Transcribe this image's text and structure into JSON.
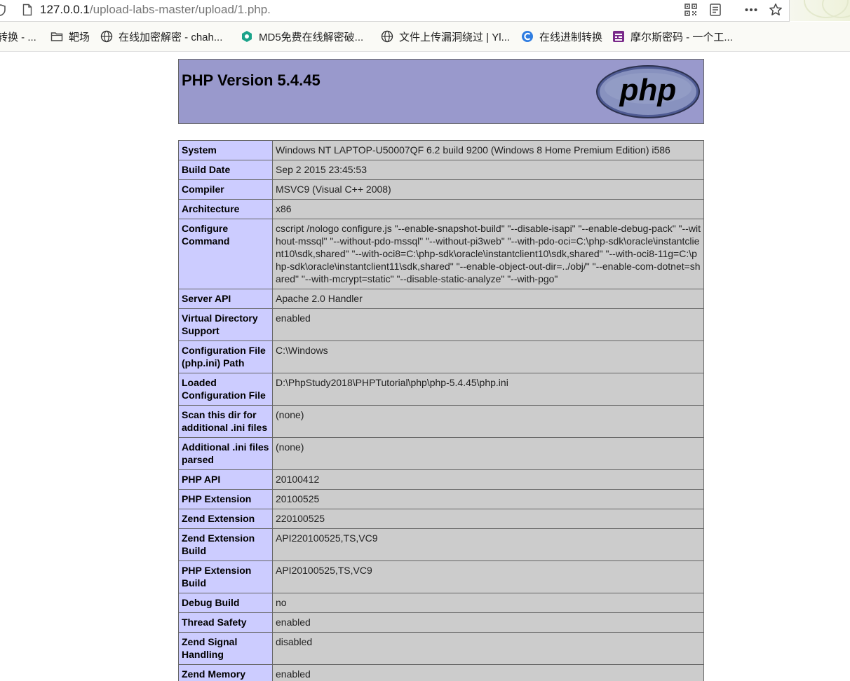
{
  "browser": {
    "url_host": "127.0.0.1",
    "url_path": "/upload-labs-master/upload/1.php.",
    "toolbar_icons": [
      "qr-code-icon",
      "reader-view-icon",
      "more-icon",
      "star-icon"
    ],
    "bookmarks": [
      {
        "label": "转换 - ...",
        "icon": "none"
      },
      {
        "label": "靶场",
        "icon": "folder-icon"
      },
      {
        "label": "在线加密解密 - chah...",
        "icon": "globe-icon"
      },
      {
        "label": "MD5免费在线解密破...",
        "icon": "md5-site-icon"
      },
      {
        "label": "文件上传漏洞绕过 | Yl...",
        "icon": "globe-icon"
      },
      {
        "label": "在线进制转换",
        "icon": "c-site-icon"
      },
      {
        "label": "摩尔斯密码 - 一个工...",
        "icon": "morse-site-icon"
      }
    ]
  },
  "page": {
    "title": "PHP Version 5.4.45",
    "logo_text": "php",
    "colors": {
      "header": "#9999cc",
      "label_cell": "#ccccff",
      "value_cell": "#cccccc"
    },
    "rows": [
      {
        "label": "System",
        "value": "Windows NT LAPTOP-U50007QF 6.2 build 9200 (Windows 8 Home Premium Edition) i586"
      },
      {
        "label": "Build Date",
        "value": "Sep 2 2015 23:45:53"
      },
      {
        "label": "Compiler",
        "value": "MSVC9 (Visual C++ 2008)"
      },
      {
        "label": "Architecture",
        "value": "x86"
      },
      {
        "label": "Configure Command",
        "value": "cscript /nologo configure.js \"--enable-snapshot-build\" \"--disable-isapi\" \"--enable-debug-pack\" \"--without-mssql\" \"--without-pdo-mssql\" \"--without-pi3web\" \"--with-pdo-oci=C:\\php-sdk\\oracle\\instantclient10\\sdk,shared\" \"--with-oci8=C:\\php-sdk\\oracle\\instantclient10\\sdk,shared\" \"--with-oci8-11g=C:\\php-sdk\\oracle\\instantclient11\\sdk,shared\" \"--enable-object-out-dir=../obj/\" \"--enable-com-dotnet=shared\" \"--with-mcrypt=static\" \"--disable-static-analyze\" \"--with-pgo\""
      },
      {
        "label": "Server API",
        "value": "Apache 2.0 Handler"
      },
      {
        "label": "Virtual Directory Support",
        "value": "enabled"
      },
      {
        "label": "Configuration File (php.ini) Path",
        "value": "C:\\Windows"
      },
      {
        "label": "Loaded Configuration File",
        "value": "D:\\PhpStudy2018\\PHPTutorial\\php\\php-5.4.45\\php.ini"
      },
      {
        "label": "Scan this dir for additional .ini files",
        "value": "(none)"
      },
      {
        "label": "Additional .ini files parsed",
        "value": "(none)"
      },
      {
        "label": "PHP API",
        "value": "20100412"
      },
      {
        "label": "PHP Extension",
        "value": "20100525"
      },
      {
        "label": "Zend Extension",
        "value": "220100525"
      },
      {
        "label": "Zend Extension Build",
        "value": "API220100525,TS,VC9"
      },
      {
        "label": "PHP Extension Build",
        "value": "API20100525,TS,VC9"
      },
      {
        "label": "Debug Build",
        "value": "no"
      },
      {
        "label": "Thread Safety",
        "value": "enabled"
      },
      {
        "label": "Zend Signal Handling",
        "value": "disabled"
      },
      {
        "label": "Zend Memory Manager",
        "value": "enabled"
      }
    ]
  }
}
